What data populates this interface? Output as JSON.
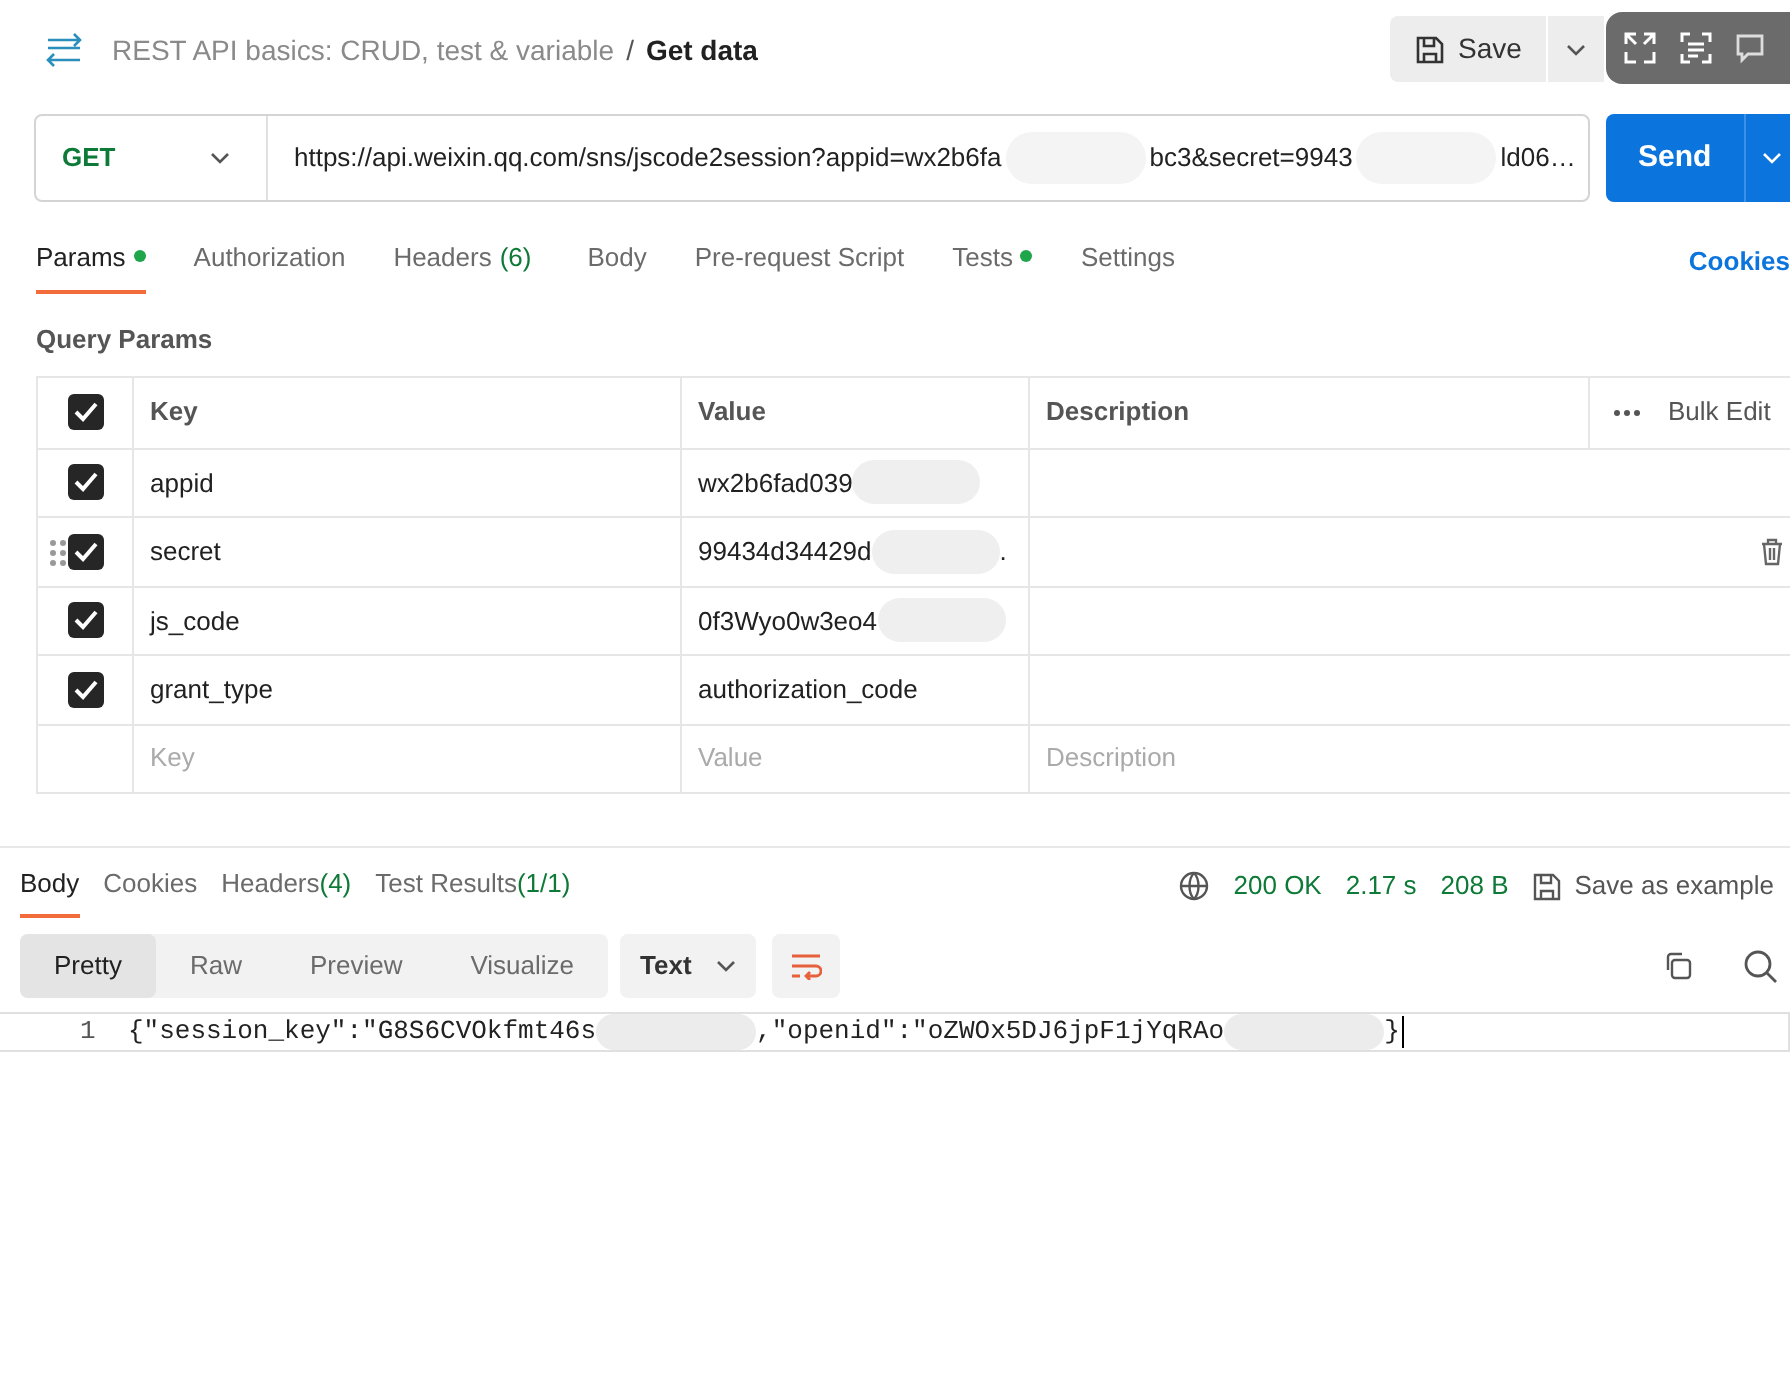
{
  "breadcrumb": {
    "collection": "REST API basics: CRUD, test & variable",
    "separator": "/",
    "request": "Get data"
  },
  "save_button": "Save",
  "request": {
    "method": "GET",
    "url_parts": [
      "https://api.weixin.qq.com/sns/jscode2session?appid=wx2b6fa",
      "bc3&secret=9943",
      "ld06…"
    ],
    "send": "Send"
  },
  "request_tabs": [
    {
      "label": "Params",
      "selected": true,
      "dot": true
    },
    {
      "label": "Authorization",
      "selected": false,
      "dot": false
    },
    {
      "label": "Headers",
      "count": "(6)",
      "selected": false,
      "dot": false
    },
    {
      "label": "Body",
      "selected": false,
      "dot": false
    },
    {
      "label": "Pre-request Script",
      "selected": false,
      "dot": false
    },
    {
      "label": "Tests",
      "selected": false,
      "dot": true
    },
    {
      "label": "Settings",
      "selected": false,
      "dot": false
    }
  ],
  "cookies_link": "Cookies",
  "query_params": {
    "title": "Query Params",
    "columns": [
      "Key",
      "Value",
      "Description"
    ],
    "bulk_edit": "Bulk Edit",
    "header_checked": true,
    "rows": [
      {
        "key": "appid",
        "value": "wx2b6fad039",
        "redacted": true,
        "checked": true,
        "hovered": false
      },
      {
        "key": "secret",
        "value": "99434d34429d",
        "redacted": true,
        "value_tail": ".",
        "checked": true,
        "hovered": true
      },
      {
        "key": "js_code",
        "value": "0f3Wyo0w3eo4",
        "redacted": true,
        "checked": true,
        "hovered": false
      },
      {
        "key": "grant_type",
        "value": "authorization_code",
        "redacted": false,
        "checked": true,
        "hovered": false
      }
    ],
    "placeholders": [
      "Key",
      "Value",
      "Description"
    ]
  },
  "response_tabs": [
    {
      "label": "Body",
      "selected": true
    },
    {
      "label": "Cookies",
      "selected": false
    },
    {
      "label": "Headers",
      "count": "(4)",
      "selected": false
    },
    {
      "label": "Test Results",
      "count": "(1/1)",
      "selected": false
    }
  ],
  "response_meta": {
    "status": "200 OK",
    "time": "2.17 s",
    "size": "208 B",
    "save_example": "Save as example"
  },
  "view_modes": [
    {
      "label": "Pretty",
      "selected": true
    },
    {
      "label": "Raw",
      "selected": false
    },
    {
      "label": "Preview",
      "selected": false
    },
    {
      "label": "Visualize",
      "selected": false
    }
  ],
  "format": "Text",
  "code_lines": [
    {
      "number": "1",
      "parts": [
        "{\"session_key\":\"G8S6CVOkfmt46s",
        ",\"openid\":\"oZWOx5DJ6jpF1jYqRAo",
        "}"
      ]
    }
  ]
}
